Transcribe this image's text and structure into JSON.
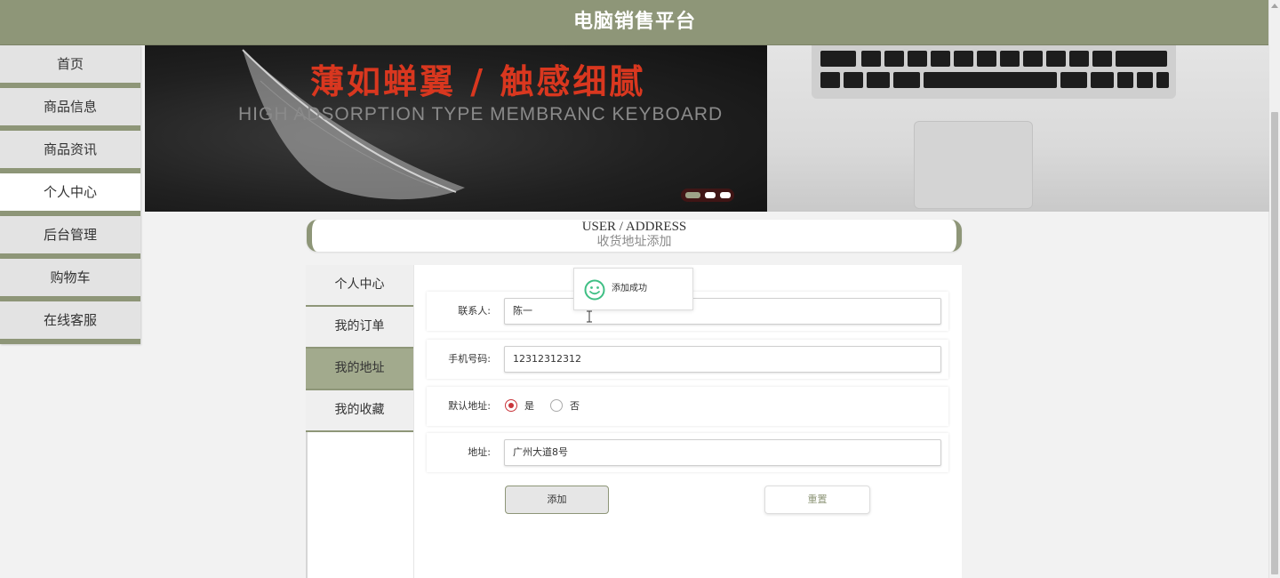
{
  "header": {
    "title": "电脑销售平台"
  },
  "sidebar": {
    "items": [
      {
        "label": "首页",
        "active": false
      },
      {
        "label": "商品信息",
        "active": false
      },
      {
        "label": "商品资讯",
        "active": false
      },
      {
        "label": "个人中心",
        "active": true
      },
      {
        "label": "后台管理",
        "active": false
      },
      {
        "label": "购物车",
        "active": false
      },
      {
        "label": "在线客服",
        "active": false
      }
    ]
  },
  "banner": {
    "headline": "薄如蝉翼 / 触感细腻",
    "subline": "HIGH ADSORPTION TYPE MEMBRANC KEYBOARD",
    "slide_count": 3,
    "active_slide": 1
  },
  "page_header": {
    "en": "USER / ADDRESS",
    "cn": "收货地址添加"
  },
  "sub_nav": {
    "items": [
      {
        "label": "个人中心",
        "active": false
      },
      {
        "label": "我的订单",
        "active": false
      },
      {
        "label": "我的地址",
        "active": true
      },
      {
        "label": "我的收藏",
        "active": false
      }
    ]
  },
  "form": {
    "contact": {
      "label": "联系人:",
      "value": "陈一"
    },
    "phone": {
      "label": "手机号码:",
      "value": "12312312312"
    },
    "default": {
      "label": "默认地址:",
      "yes": "是",
      "no": "否",
      "selected": "是"
    },
    "address": {
      "label": "地址:",
      "value": "广州大道8号"
    },
    "add_label": "添加",
    "reset_label": "重置"
  },
  "toast": {
    "message": "添加成功",
    "icon": "smile-icon"
  },
  "colors": {
    "brand": "#8e9678",
    "active_nav": "#a2aa8d",
    "headline": "#d9371f",
    "radio": "#c9353b",
    "toast_icon": "#3fbf84"
  }
}
